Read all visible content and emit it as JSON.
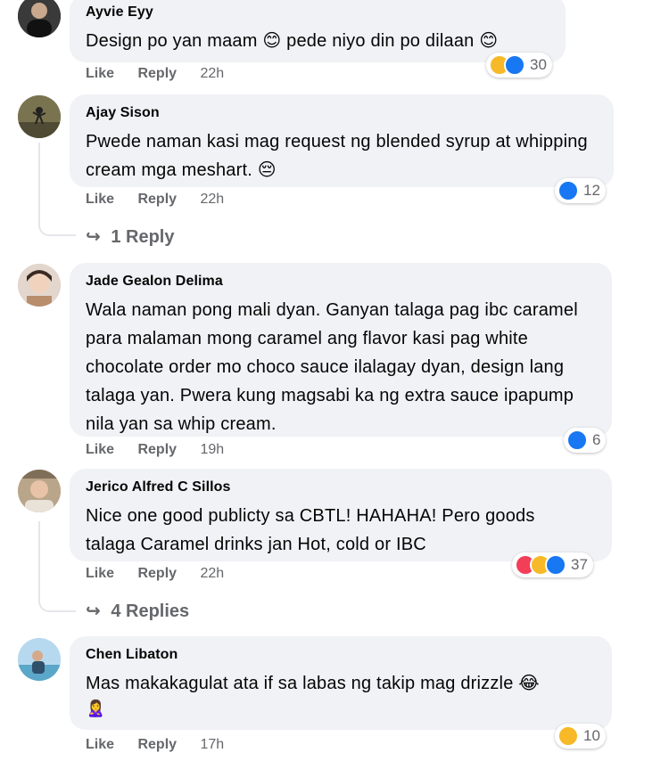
{
  "comments": [
    {
      "name": "Ayvie Eyy",
      "text": "Design po yan maam 😊 pede niyo din po dilaan 😊",
      "actions": {
        "like": "Like",
        "reply": "Reply",
        "time": "22h"
      },
      "reactions": {
        "icons": [
          "haha",
          "like"
        ],
        "count": "30"
      }
    },
    {
      "name": "Ajay Sison",
      "text": "Pwede naman kasi mag request ng blended syrup at whipping cream mga meshart. 😔",
      "actions": {
        "like": "Like",
        "reply": "Reply",
        "time": "22h"
      },
      "reactions": {
        "icons": [
          "like"
        ],
        "count": "12"
      },
      "replies_link": "1 Reply"
    },
    {
      "name": "Jade Gealon Delima",
      "text": "Wala naman pong mali dyan. Ganyan talaga pag ibc caramel para malaman mong caramel ang flavor kasi pag white chocolate order mo choco sauce ilalagay dyan, design lang talaga yan. Pwera kung magsabi ka ng extra sauce ipapump nila yan sa whip cream.",
      "actions": {
        "like": "Like",
        "reply": "Reply",
        "time": "19h"
      },
      "reactions": {
        "icons": [
          "like"
        ],
        "count": "6"
      }
    },
    {
      "name": "Jerico Alfred C Sillos",
      "text": "Nice one good publicty sa CBTL! HAHAHA! Pero goods talaga Caramel drinks jan Hot, cold or IBC",
      "actions": {
        "like": "Like",
        "reply": "Reply",
        "time": "22h"
      },
      "reactions": {
        "icons": [
          "love",
          "haha",
          "like"
        ],
        "count": "37"
      },
      "replies_link": "4 Replies"
    },
    {
      "name": "Chen Libaton",
      "text": "Mas makakagulat ata if sa labas ng takip mag drizzle 😂",
      "extra_emoji": "🙎‍♀️",
      "actions": {
        "like": "Like",
        "reply": "Reply",
        "time": "17h"
      },
      "reactions": {
        "icons": [
          "haha"
        ],
        "count": "10"
      }
    }
  ],
  "colors": {
    "bubble": "#f0f2f5",
    "meta": "#65676b",
    "like": "#1877f2",
    "haha": "#f7b928",
    "love": "#f33e58"
  }
}
